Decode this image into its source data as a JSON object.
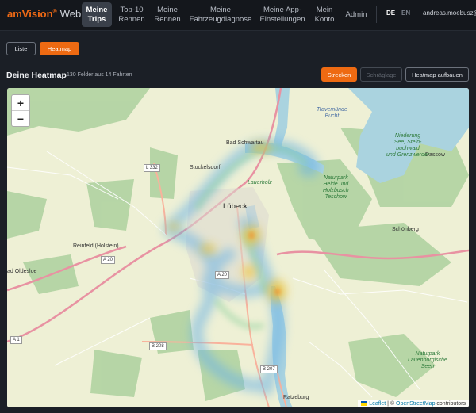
{
  "brand": {
    "name": "amVision",
    "reg": "®",
    "suffix": "Web"
  },
  "nav": [
    {
      "label": "Meine\nTrips",
      "active": true
    },
    {
      "label": "Top-10\nRennen",
      "active": false
    },
    {
      "label": "Meine\nRennen",
      "active": false
    },
    {
      "label": "Meine\nFahrzeugdiagnose",
      "active": false
    },
    {
      "label": "Meine App-\nEinstellungen",
      "active": false
    },
    {
      "label": "Mein\nKonto",
      "active": false
    },
    {
      "label": "Admin",
      "active": false
    }
  ],
  "language": {
    "de": "DE",
    "en": "EN",
    "selected": "DE"
  },
  "user": {
    "email": "andreas.moebusz@"
  },
  "view_toggle": {
    "list": "Liste",
    "heatmap": "Heatmap",
    "selected": "Heatmap"
  },
  "heatmap": {
    "title": "Deine Heatmap",
    "subtitle": "130 Felder aus 14 Fahrten",
    "mode_routes": "Strecken",
    "mode_oblique": "Schräglage",
    "build_button": "Heatmap aufbauen",
    "selected_mode": "Strecken"
  },
  "map": {
    "zoom_in": "+",
    "zoom_out": "−",
    "attribution": {
      "leaflet": "Leaflet",
      "separator": " | © ",
      "osm": "OpenStreetMap",
      "suffix": " contributors"
    },
    "places": {
      "luebeck": "Lübeck",
      "bad_schwartau": "Bad Schwartau",
      "stockelsdorf": "Stockelsdorf",
      "reinfeld": "Reinfeld (Holstein)",
      "bad_oldesloe": "ad Oldesloe",
      "schoenberg": "Schönberg",
      "dassow": "Dassow",
      "ratzeburg": "Ratzeburg",
      "travemuende": "Travemünde\nBucht",
      "lauerholz": "Lauerholz",
      "teschow": "Naturpark\nHeide und\nHolzbusch\nTeschow",
      "dassow_see": "Niederung\nSee, Stein-\nbuchwald\nund Grenzwerder",
      "ratzeburg_lakes": "Naturpark\nLauenburgische\nSeen"
    },
    "roads": {
      "l332": "L 332",
      "a20_west": "A 20",
      "a20_south": "A 20",
      "a1": "A 1",
      "b208": "B 208",
      "b207": "B 207"
    },
    "colors": {
      "water": "#aad3df",
      "forest": "#add19e",
      "farmland": "#eef0d5",
      "motorway": "#e892a2",
      "trunk": "#f9b29c",
      "heat_low": "#6bb2e6",
      "heat_high": "#f4c430"
    }
  }
}
